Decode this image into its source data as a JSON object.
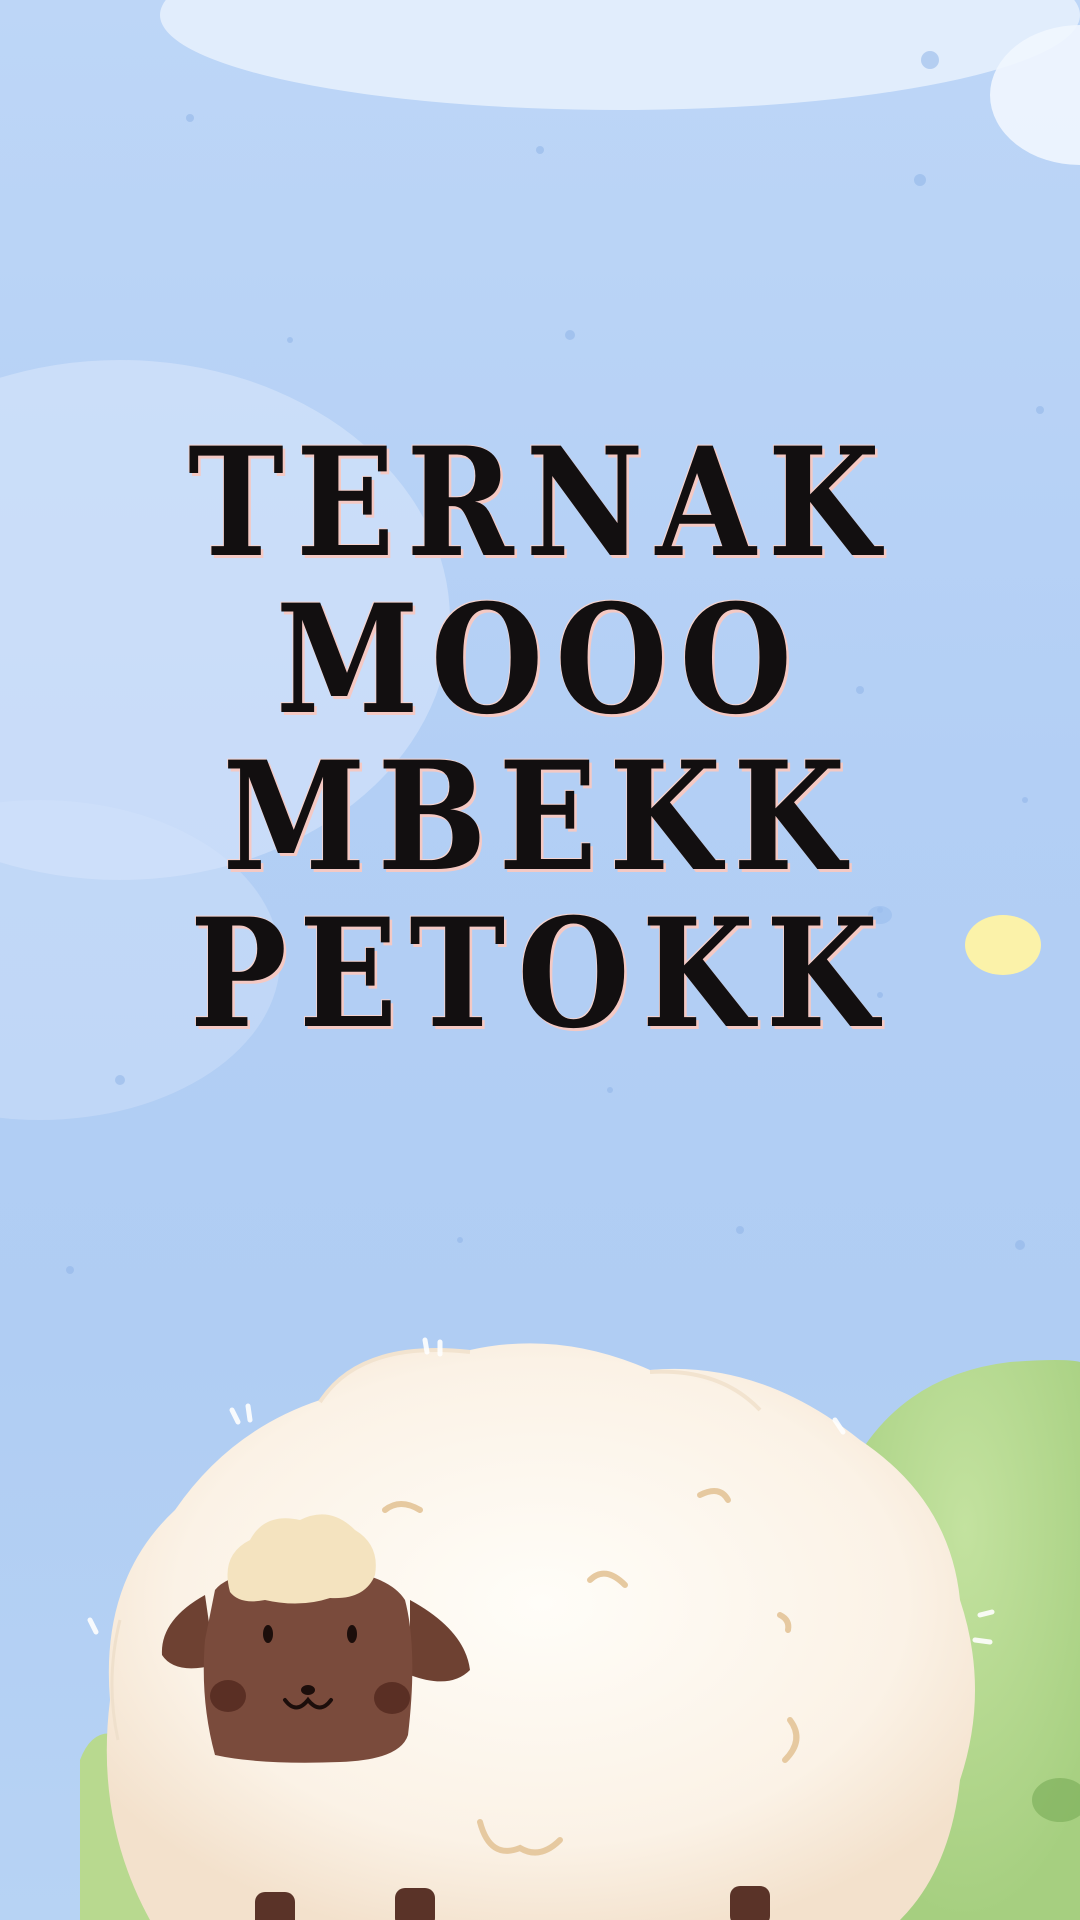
{
  "title": {
    "lines": [
      "TERNAK",
      "MOOO",
      "MBEKK",
      "PETOKK"
    ]
  },
  "colors": {
    "sky": "#b3cff5",
    "title_text": "#120f10",
    "title_outline": "#f4c9c4",
    "hill": "#b2d78b",
    "wool": "#fbf3e9",
    "sheep_face": "#7a4b3c",
    "sun": "#fbf2a9"
  },
  "icons": [
    "sheep-illustration",
    "hill",
    "cloud",
    "sun"
  ]
}
